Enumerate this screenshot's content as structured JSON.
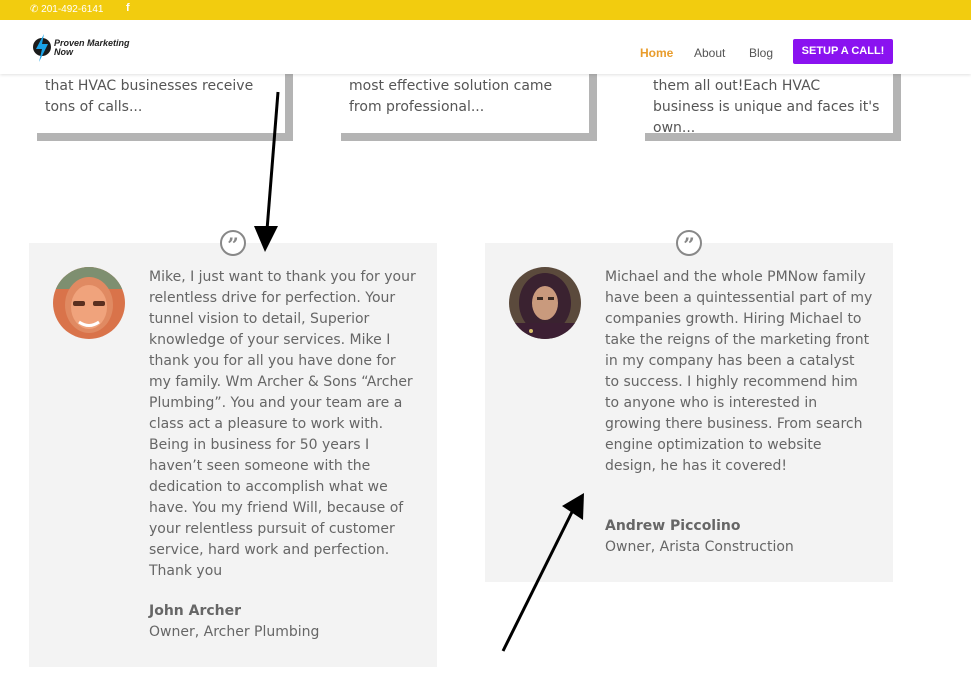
{
  "topbar": {
    "phone": "201-492-6141",
    "facebook_icon": "facebook-icon",
    "color": "#f2cc0f"
  },
  "header": {
    "logo_text": "Proven Marketing Now",
    "nav": {
      "home": "Home",
      "about": "About",
      "blog": "Blog"
    },
    "cta": "SETUP A CALL!",
    "accent_active": "#e89c2c",
    "cta_color": "#8a12f0"
  },
  "cards": [
    {
      "excerpt": "that HVAC businesses receive tons of calls..."
    },
    {
      "excerpt": "most effective solution came from professional..."
    },
    {
      "excerpt": "them all out!Each HVAC business is unique and faces it's own..."
    }
  ],
  "testimonials": [
    {
      "quote": "Mike, I just want to thank you for your relentless drive for perfection. Your tunnel vision to detail, Superior knowledge of your services. Mike I thank you for all you have done for my family. Wm Archer & Sons “Archer Plumbing”. You and your team are a class act a pleasure to work with. Being in business for 50 years I haven’t seen someone with the dedication to accomplish what we have. You my friend Will, because of your relentless pursuit of customer service, hard work and perfection. Thank you",
      "name": "John Archer",
      "role": "Owner, Archer Plumbing"
    },
    {
      "quote": "Michael and the whole PMNow family have been a quintessential part of my companies growth. Hiring Michael to take the reigns of the marketing front in my company has been a catalyst to success. I highly recommend him to anyone who is interested in growing there business. From search engine optimization to website design, he has it covered!",
      "name": "Andrew Piccolino",
      "role": "Owner, Arista Construction"
    }
  ],
  "quote_icon": "quote-icon"
}
